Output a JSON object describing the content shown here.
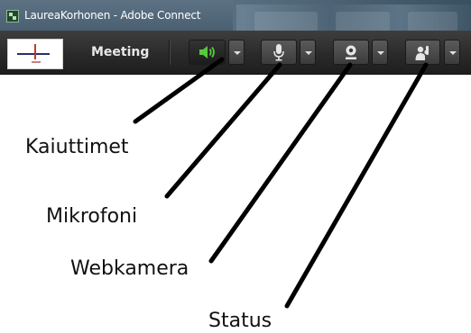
{
  "window": {
    "title": "LaureaKorhonen - Adobe Connect"
  },
  "toolbar": {
    "menu_label": "Meeting",
    "speaker_color": "#58c93a"
  },
  "labels": {
    "speakers": "Kaiuttimet",
    "microphone": "Mikrofoni",
    "webcam": "Webkamera",
    "status": "Status"
  }
}
